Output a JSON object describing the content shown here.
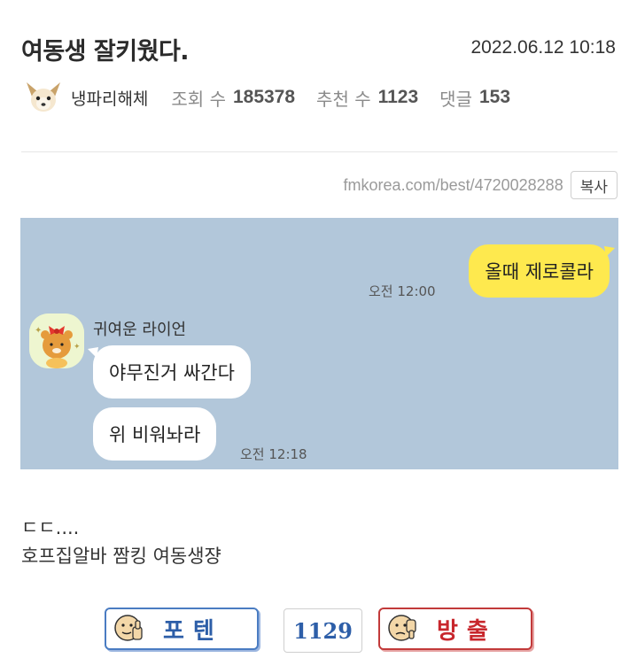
{
  "post": {
    "title": "여동생 잘키웠다.",
    "date": "2022.06.12 10:18",
    "author": "냉파리해체",
    "views_label": "조회 수",
    "views": "185378",
    "recommend_label": "추천 수",
    "recommend": "1123",
    "comments_label": "댓글",
    "comments": "153"
  },
  "link": {
    "url": "fmkorea.com/best/4720028288",
    "copy_label": "복사"
  },
  "chat": {
    "background": "#b2c7da",
    "my_message": "올때 제로콜라",
    "my_time": "오전 12:00",
    "sender_name": "귀여운 라이언",
    "reply_1": "야무진거 싸간다",
    "reply_2": "위 비워놔라",
    "reply_time": "오전 12:18"
  },
  "body": {
    "line1": "ㄷㄷ....",
    "line2": "호프집알바 짬킹 여동생쟝"
  },
  "votes": {
    "up_label": "포텐",
    "count": "1129",
    "down_label": "방출",
    "up_color": "#2d5ea8",
    "down_color": "#c8272d"
  }
}
